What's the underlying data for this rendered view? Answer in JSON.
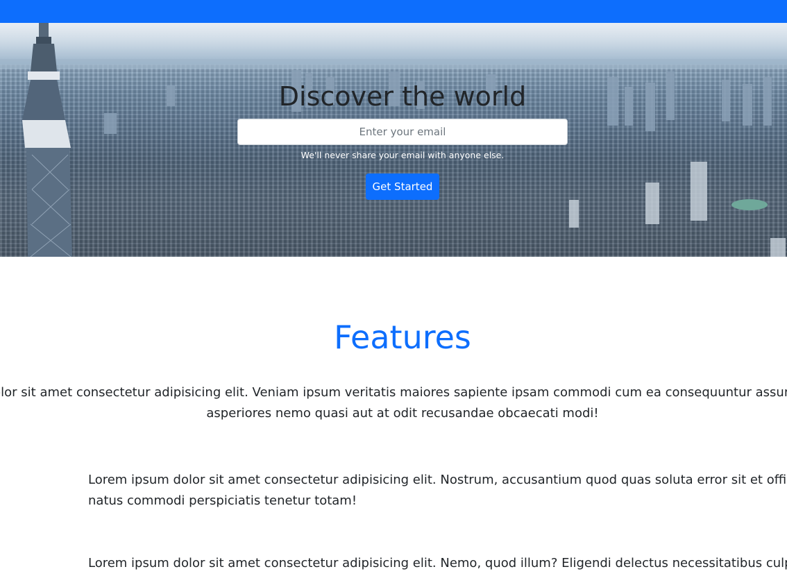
{
  "navbar": {
    "color": "#0d6efd"
  },
  "hero": {
    "title": "Discover the world",
    "email_placeholder": "Enter your email",
    "help_text": "We'll never share your email with anyone else.",
    "cta_label": "Get Started",
    "background_description_icon": "city-skyline-photo"
  },
  "features": {
    "title": "Features",
    "lead_line1": "olor sit amet consectetur adipisicing elit. Veniam ipsum veritatis maiores sapiente ipsam commodi cum ea consequuntur assumen",
    "lead_line2": "asperiores nemo quasi aut at odit recusandae obcaecati modi!",
    "items": [
      {
        "icon": "feature-icon",
        "line1": "Lorem ipsum dolor sit amet consectetur adipisicing elit. Nostrum, accusantium quod quas soluta error sit et officiis",
        "line2": "natus commodi perspiciatis tenetur totam!"
      },
      {
        "icon": "feature-icon",
        "line1": "Lorem ipsum dolor sit amet consectetur adipisicing elit. Nemo, quod illum? Eligendi delectus necessitatibus culpa?",
        "line2": ""
      }
    ]
  },
  "colors": {
    "accent": "#0d6efd",
    "text": "#212529",
    "muted": "#6c757d"
  }
}
